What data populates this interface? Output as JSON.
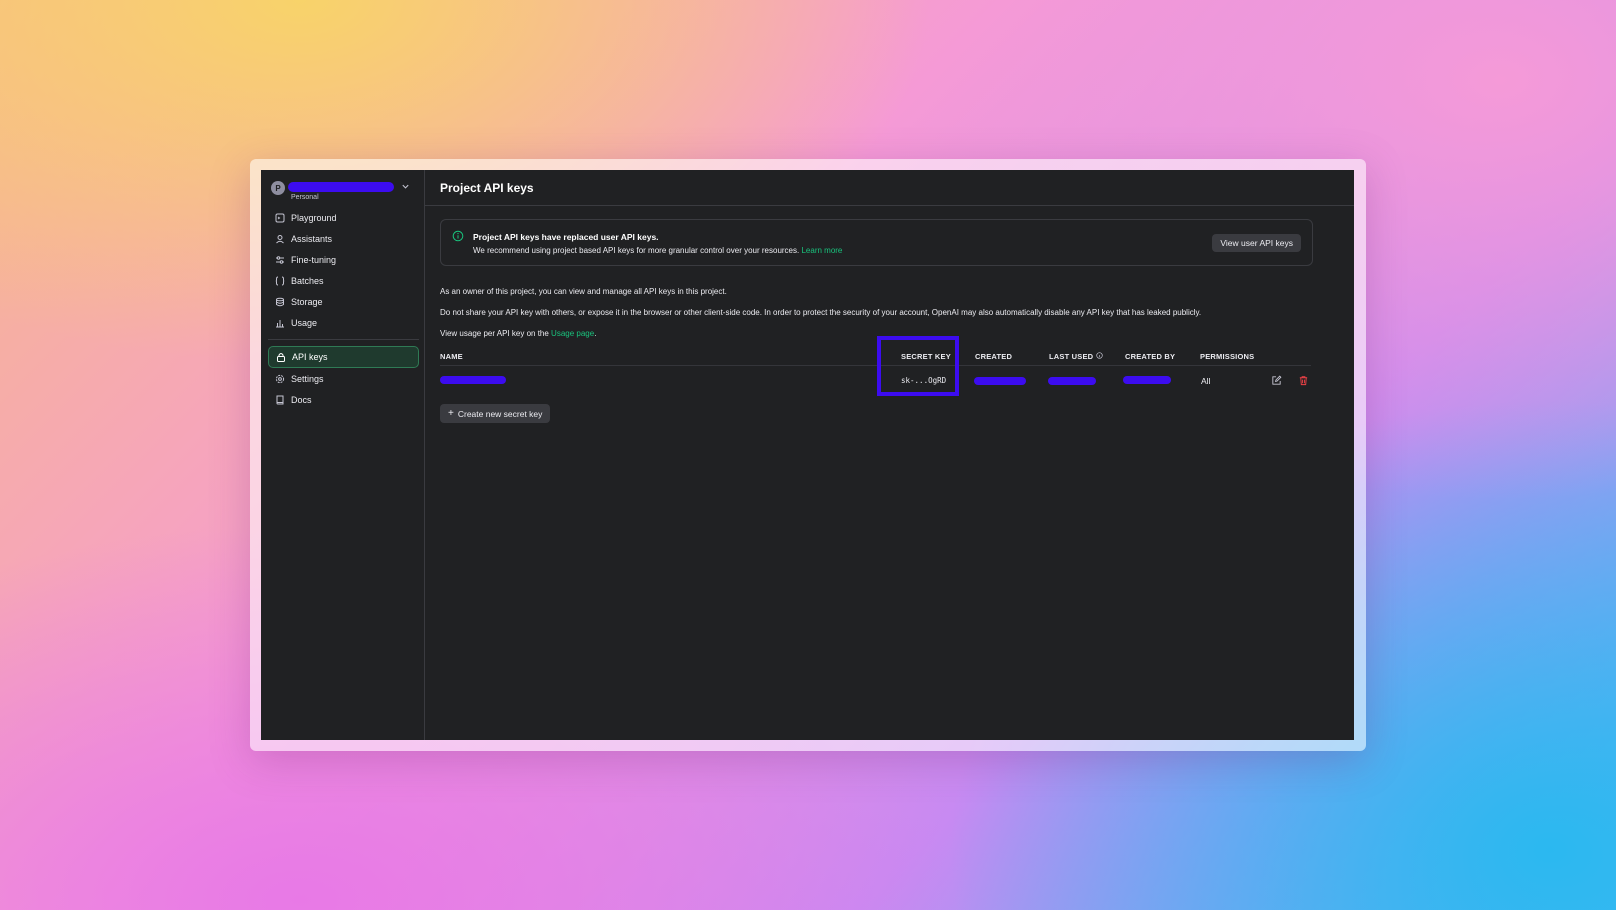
{
  "org": {
    "avatar_letter": "P",
    "name": "redacted",
    "subtitle": "Personal"
  },
  "sidebar": {
    "items": [
      {
        "label": "Playground",
        "icon": "playground-icon"
      },
      {
        "label": "Assistants",
        "icon": "assistants-icon"
      },
      {
        "label": "Fine-tuning",
        "icon": "fine-tuning-icon"
      },
      {
        "label": "Batches",
        "icon": "batches-icon"
      },
      {
        "label": "Storage",
        "icon": "storage-icon"
      },
      {
        "label": "Usage",
        "icon": "usage-icon"
      }
    ],
    "items2": [
      {
        "label": "API keys",
        "icon": "lock-icon",
        "active": true
      },
      {
        "label": "Settings",
        "icon": "gear-icon"
      },
      {
        "label": "Docs",
        "icon": "book-icon"
      }
    ]
  },
  "header": {
    "title": "Project API keys"
  },
  "notice": {
    "title": "Project API keys have replaced user API keys.",
    "text": "We recommend using project based API keys for more granular control over your resources.",
    "link": "Learn more",
    "button": "View user API keys"
  },
  "info": {
    "line1": "As an owner of this project, you can view and manage all API keys in this project.",
    "line2": "Do not share your API key with others, or expose it in the browser or other client-side code. In order to protect the security of your account, OpenAI may also automatically disable any API key that has leaked publicly.",
    "line3_prefix": "View usage per API key on the ",
    "line3_link": "Usage page",
    "line3_suffix": "."
  },
  "table": {
    "headers": {
      "name": "NAME",
      "secret_key": "SECRET KEY",
      "created": "CREATED",
      "last_used": "LAST USED",
      "created_by": "CREATED BY",
      "permissions": "PERMISSIONS"
    },
    "rows": [
      {
        "name": "redacted",
        "secret_key": "sk-...OgRD",
        "created": "redacted",
        "last_used": "redacted",
        "created_by": "redacted",
        "permissions": "All"
      }
    ]
  },
  "create_button": "Create new secret key",
  "colors": {
    "accent": "#19c37d",
    "highlight": "#3c0cf0",
    "danger": "#ef4146"
  }
}
